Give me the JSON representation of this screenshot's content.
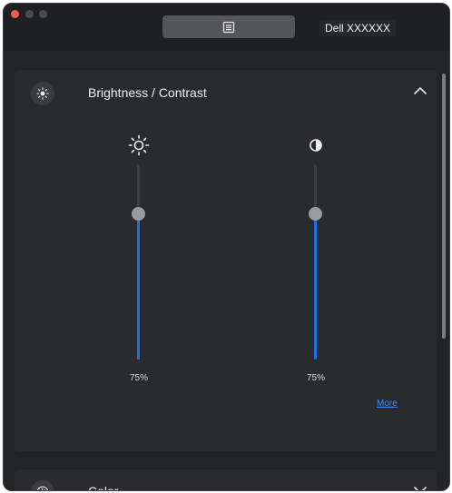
{
  "window": {
    "tab_icon": "document-icon",
    "monitor_name": "Dell XXXXXX"
  },
  "brightness_contrast": {
    "title": "Brightness / Contrast",
    "section_icon": "brightness-icon",
    "expanded": true,
    "brightness": {
      "icon": "sun-icon",
      "value_label": "75%",
      "level": 0.75
    },
    "contrast": {
      "icon": "contrast-icon",
      "value_label": "75%",
      "level": 0.75
    },
    "more_label": "More"
  },
  "color": {
    "title": "Color",
    "section_icon": "palette-icon",
    "expanded": false
  },
  "colors": {
    "accent": "#1d6fe8",
    "link": "#3a8cff",
    "background": "#1f2023"
  }
}
